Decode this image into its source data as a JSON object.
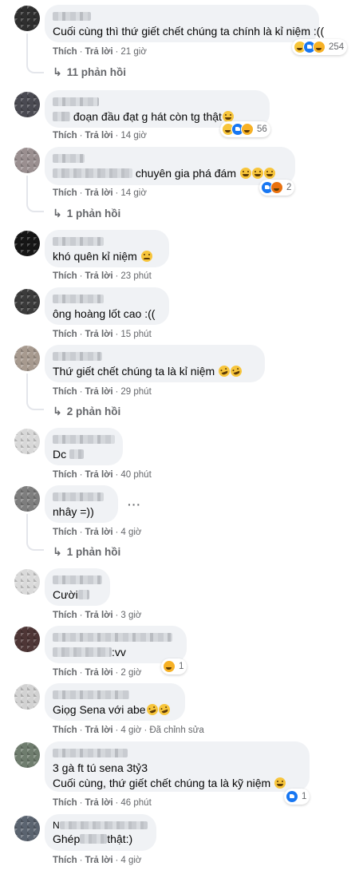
{
  "labels": {
    "like": "Thích",
    "reply": "Trả lời",
    "edited": "Đã chỉnh sửa"
  },
  "comments": [
    {
      "text": "Cuối cùng thì thứ giết chết chúng ta chính là kỉ niệm :((",
      "time": "21 giờ",
      "reaction_count": "254",
      "replies": "11 phản hồi"
    },
    {
      "text": "đoạn đầu đạt g hát còn tg thật",
      "time": "14 giờ",
      "reaction_count": "56"
    },
    {
      "text": "chuyên gia phá đám",
      "time": "14 giờ",
      "reaction_count": "2",
      "replies": "1 phản hồi"
    },
    {
      "text": "khó quên kỉ niệm",
      "time": "23 phút"
    },
    {
      "text": "ông hoàng lốt cao :((",
      "time": "15 phút"
    },
    {
      "text": "Thứ giết chết chúng ta là kỉ niệm",
      "time": "29 phút",
      "replies": "2 phản hồi"
    },
    {
      "text": "Dc",
      "time": "40 phút"
    },
    {
      "text": "nhây =))",
      "time": "4 giờ",
      "more": "···",
      "replies": "1 phản hồi"
    },
    {
      "text": "Cười",
      "time": "3 giờ"
    },
    {
      "text": ":vv",
      "time": "2 giờ",
      "reaction_count": "1"
    },
    {
      "text": "Giọg Sena với abe",
      "time": "4 giờ"
    },
    {
      "text_line1": "3 gà ft tú sena 3tỷ3",
      "text_line2": "Cuối cùng, thứ giết chết chúng ta là kỹ niệm",
      "time": "46 phút",
      "reaction_count": "1"
    },
    {
      "text_prefix": "N",
      "text": "Ghép",
      "text_suffix": "thật:)",
      "time": "4 giờ"
    }
  ]
}
